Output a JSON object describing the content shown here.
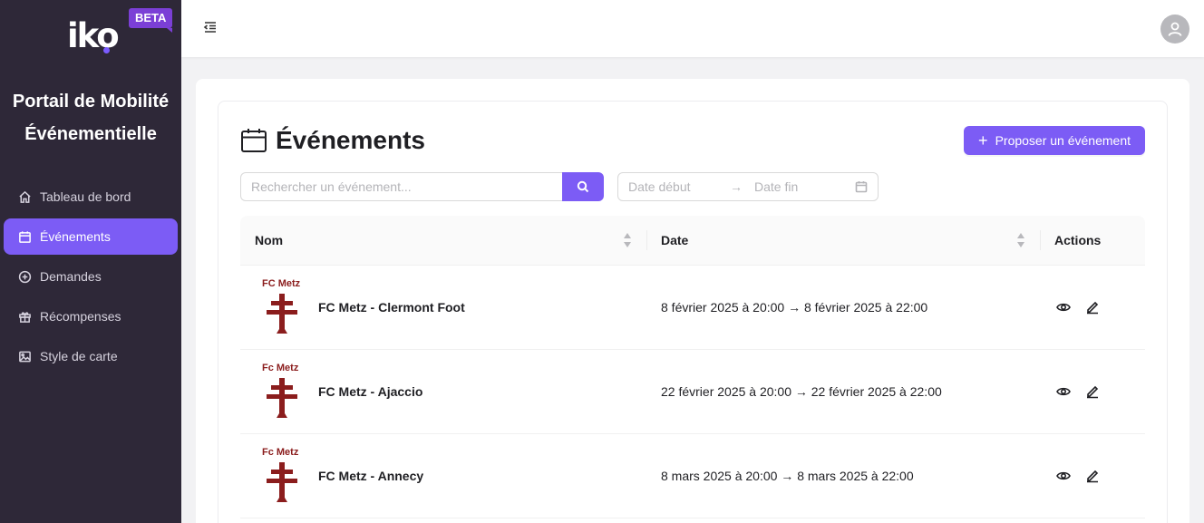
{
  "app": {
    "logo_text": "iko",
    "beta_label": "BETA",
    "portal_title_line1": "Portail de Mobilité",
    "portal_title_line2": "Événementielle"
  },
  "sidebar": {
    "items": [
      {
        "label": "Tableau de bord",
        "icon": "home-icon",
        "active": false
      },
      {
        "label": "Événements",
        "icon": "calendar-icon",
        "active": true
      },
      {
        "label": "Demandes",
        "icon": "plus-circle-icon",
        "active": false
      },
      {
        "label": "Récompenses",
        "icon": "gift-icon",
        "active": false
      },
      {
        "label": "Style de carte",
        "icon": "image-icon",
        "active": false
      }
    ]
  },
  "header": {
    "menu_icon": "menu-fold-icon",
    "avatar_icon": "user-icon"
  },
  "main": {
    "title": "Événements",
    "propose_button": "Proposer un événement",
    "search": {
      "placeholder": "Rechercher un événement...",
      "value": ""
    },
    "date_range": {
      "start_placeholder": "Date début",
      "end_placeholder": "Date fin"
    },
    "table": {
      "columns": [
        "Nom",
        "Date",
        "Actions"
      ],
      "rows": [
        {
          "club_logo_text": "FC Metz",
          "name": "FC Metz - Clermont Foot",
          "date": "8 février 2025 à 20:00 → 8 février 2025 à 22:00"
        },
        {
          "club_logo_text": "Fc Metz",
          "name": "FC Metz - Ajaccio",
          "date": "22 février 2025 à 20:00 → 22 février 2025 à 22:00"
        },
        {
          "club_logo_text": "Fc Metz",
          "name": "FC Metz - Annecy",
          "date": "8 mars 2025 à 20:00 → 8 mars 2025 à 22:00"
        }
      ]
    }
  },
  "colors": {
    "sidebar_bg": "#2e2838",
    "accent": "#7c5cf5",
    "beta_bg": "#7b3fd6",
    "club_red": "#8b1d1d"
  }
}
